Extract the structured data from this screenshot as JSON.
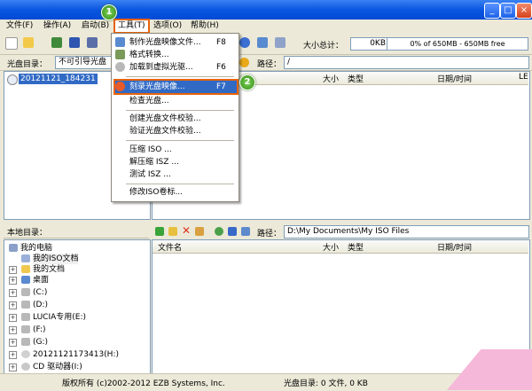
{
  "menubar": {
    "items": [
      "文件(F)",
      "操作(A)",
      "启动(B)",
      "工具(T)",
      "选项(O)",
      "帮助(H)"
    ]
  },
  "toolbar": {
    "total_size_label": "大小总计：",
    "total_size_value": "0KB",
    "capacity_text": "0% of 650MB - 650MB free"
  },
  "disc_bar": {
    "label": "光盘目录：",
    "boot_value": "不可引导光盘",
    "path_label": "路径：",
    "path_value": "/"
  },
  "upper_pane": {
    "root_item": "20121121_184231",
    "columns": [
      "大小",
      "类型",
      "日期/时间",
      "LE"
    ]
  },
  "tools_menu": {
    "items": [
      {
        "label": "制作光盘映像文件...",
        "key": "F8"
      },
      {
        "label": "格式转换...",
        "key": ""
      },
      {
        "label": "加载到虚拟光驱...",
        "key": "F6"
      },
      {
        "label": "刻录光盘映像...",
        "key": "F7"
      },
      {
        "label": "检查光盘...",
        "key": ""
      },
      {
        "label": "创建光盘文件校验...",
        "key": ""
      },
      {
        "label": "验证光盘文件校验...",
        "key": ""
      },
      {
        "label": "压缩 ISO ...",
        "key": ""
      },
      {
        "label": "解压缩 ISZ ...",
        "key": ""
      },
      {
        "label": "测试 ISZ ...",
        "key": ""
      },
      {
        "label": "修改ISO卷标...",
        "key": ""
      }
    ]
  },
  "local_bar": {
    "label": "本地目录：",
    "path_label": "路径：",
    "path_value": "D:\\My Documents\\My ISO Files"
  },
  "lower_pane": {
    "columns": [
      "文件名",
      "大小",
      "类型",
      "日期/时间"
    ]
  },
  "local_tree": [
    "我的电脑",
    "我的ISO文档",
    "我的文档",
    "桌面",
    "(C:)",
    "(D:)",
    "LUCIA专用(E:)",
    "(F:)",
    "(G:)",
    "20121121173413(H:)",
    "CD 驱动器(I:)"
  ],
  "status": {
    "copyright": "版权所有 (c)2002-2012 EZB Systems, Inc.",
    "disc_dir": "光盘目录: 0 文件, 0 KB"
  },
  "badges": [
    "1",
    "2"
  ],
  "colors": {
    "titlebar": "#0a56e0",
    "highlight": "#e8630a",
    "selection": "#316ac5",
    "badge": "#2f8b12",
    "corner": "#f5b8d8"
  }
}
